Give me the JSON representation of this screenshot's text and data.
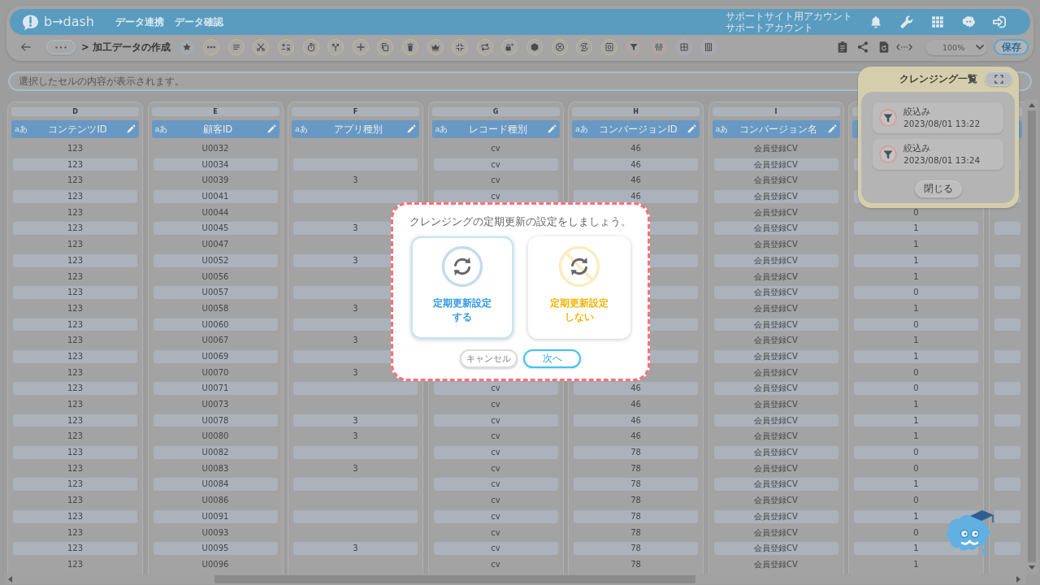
{
  "header": {
    "logo": "b→dash",
    "nav": [
      {
        "label": "データ連携"
      },
      {
        "label": "データ確認"
      }
    ],
    "account": [
      "サポートサイト用アカウント",
      "サポートアカウント"
    ]
  },
  "toolbar": {
    "breadcrumb": "> 加工データの作成",
    "tool_buttons": [
      {
        "color": "#8ea9cc"
      },
      {
        "color": "#c9b98a"
      },
      {
        "color": "#c9b98a"
      },
      {
        "color": "#c9b98a"
      },
      {
        "color": "#c9b98a"
      },
      {
        "color": "#c9b98a"
      },
      {
        "color": "#c9b98a"
      },
      {
        "color": "#c9b98a"
      },
      {
        "color": "#c9b98a"
      },
      {
        "color": "#c9b98a"
      },
      {
        "color": "#c9b98a"
      },
      {
        "color": "#c9b98a"
      },
      {
        "color": "#c9b98a"
      },
      {
        "color": "#b4bf93"
      },
      {
        "color": "#b4bf93"
      },
      {
        "color": "#b4bf93"
      },
      {
        "color": "#b4bf93"
      },
      {
        "color": "#b4bf93"
      },
      {
        "color": "#d69292"
      },
      {
        "color": "#d69292"
      },
      {
        "color": "#b3a4cf"
      },
      {
        "color": "#b3a4cf"
      }
    ],
    "zoom": "100%",
    "save": "保存"
  },
  "cell_view": {
    "placeholder": "選択したセルの内容が表示されます。"
  },
  "table": {
    "columns": [
      {
        "letter": "D",
        "type_label": "aあ",
        "name": "コンテンツID"
      },
      {
        "letter": "E",
        "type_label": "aあ",
        "name": "顧客ID"
      },
      {
        "letter": "F",
        "type_label": "aあ",
        "name": "アプリ種別"
      },
      {
        "letter": "G",
        "type_label": "aあ",
        "name": "レコード種別"
      },
      {
        "letter": "H",
        "type_label": "aあ",
        "name": "コンバージョンID"
      },
      {
        "letter": "I",
        "type_label": "aあ",
        "name": "コンバージョン名"
      }
    ],
    "rows": [
      [
        "123",
        "U0032",
        null,
        "cv",
        "46",
        "会員登録CV",
        null
      ],
      [
        "123",
        "U0034",
        null,
        "cv",
        "46",
        "会員登録CV",
        null
      ],
      [
        "123",
        "U0039",
        "3",
        "cv",
        "46",
        "会員登録CV",
        null
      ],
      [
        "123",
        "U0041",
        null,
        "cv",
        "46",
        "会員登録CV",
        null
      ],
      [
        "123",
        "U0044",
        null,
        null,
        null,
        "会員登録CV",
        "0"
      ],
      [
        "123",
        "U0045",
        "3",
        null,
        null,
        "会員登録CV",
        "1"
      ],
      [
        "123",
        "U0047",
        null,
        null,
        null,
        "会員登録CV",
        "1"
      ],
      [
        "123",
        "U0052",
        "3",
        null,
        null,
        "会員登録CV",
        "1"
      ],
      [
        "123",
        "U0056",
        null,
        null,
        null,
        "会員登録CV",
        "1"
      ],
      [
        "123",
        "U0057",
        null,
        null,
        null,
        "会員登録CV",
        "0"
      ],
      [
        "123",
        "U0058",
        "3",
        null,
        null,
        "会員登録CV",
        "1"
      ],
      [
        "123",
        "U0060",
        null,
        null,
        null,
        "会員登録CV",
        "0"
      ],
      [
        "123",
        "U0067",
        "3",
        null,
        null,
        "会員登録CV",
        "1"
      ],
      [
        "123",
        "U0069",
        null,
        null,
        null,
        "会員登録CV",
        "1"
      ],
      [
        "123",
        "U0070",
        "3",
        null,
        null,
        "会員登録CV",
        "0"
      ],
      [
        "123",
        "U0071",
        null,
        "cv",
        "46",
        "会員登録CV",
        "0"
      ],
      [
        "123",
        "U0073",
        null,
        "cv",
        "46",
        "会員登録CV",
        "1"
      ],
      [
        "123",
        "U0078",
        "3",
        "cv",
        "46",
        "会員登録CV",
        "1"
      ],
      [
        "123",
        "U0080",
        "3",
        "cv",
        "46",
        "会員登録CV",
        "1"
      ],
      [
        "123",
        "U0082",
        null,
        "cv",
        "78",
        "会員登録CV",
        "0"
      ],
      [
        "123",
        "U0083",
        "3",
        "cv",
        "78",
        "会員登録CV",
        "0"
      ],
      [
        "123",
        "U0084",
        null,
        "cv",
        "78",
        "会員登録CV",
        "1"
      ],
      [
        "123",
        "U0086",
        null,
        "cv",
        "78",
        "会員登録CV",
        "0"
      ],
      [
        "123",
        "U0091",
        null,
        "cv",
        "78",
        "会員登録CV",
        "1"
      ],
      [
        "123",
        "U0093",
        null,
        "cv",
        "78",
        "会員登録CV",
        "0"
      ],
      [
        "123",
        "U0095",
        "3",
        "cv",
        "78",
        "会員登録CV",
        "1"
      ],
      [
        "123",
        "U0096",
        null,
        "cv",
        "78",
        "会員登録CV",
        "1"
      ]
    ]
  },
  "cleansing_panel": {
    "title": "クレンジング一覧",
    "items": [
      {
        "label": "絞込み",
        "time": "2023/08/01 13:22"
      },
      {
        "label": "絞込み",
        "time": "2023/08/01 13:24"
      }
    ],
    "close": "閉じる"
  },
  "dialog": {
    "message": "クレンジングの定期更新の設定をしましょう。",
    "options": [
      {
        "kind": "enable",
        "label": "定期更新設定する",
        "selected": true
      },
      {
        "kind": "disable",
        "label": "定期更新設定しない",
        "selected": false
      }
    ],
    "buttons": [
      {
        "kind": "secondary",
        "label": "キャンセル"
      },
      {
        "kind": "primary",
        "label": "次へ"
      }
    ]
  }
}
